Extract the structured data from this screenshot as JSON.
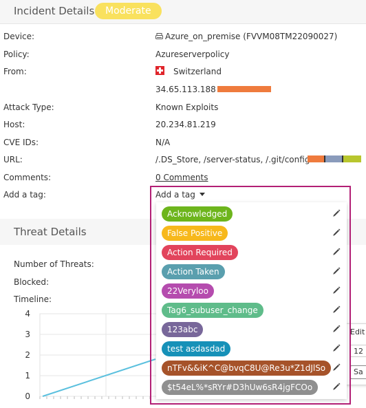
{
  "header": {
    "title": "Incident Details",
    "severity": "Moderate"
  },
  "details": {
    "device_label": "Device:",
    "device_value": "Azure_on_premise (FVVM08TM22090027)",
    "policy_label": "Policy:",
    "policy_value": "Azureserverpolicy",
    "from_label": "From:",
    "from_country": "Switzerland",
    "from_ip": "34.65.113.188",
    "attack_type_label": "Attack Type:",
    "attack_type_value": "Known Exploits",
    "host_label": "Host:",
    "host_value": "20.234.81.219",
    "cve_label": "CVE IDs:",
    "cve_value": "N/A",
    "url_label": "URL:",
    "url_value": "/.DS_Store, /server-status, /.git/config",
    "comments_label": "Comments:",
    "comments_link": "0 Comments",
    "add_tag_label": "Add a tag:"
  },
  "icons": {
    "device": "printer-icon",
    "flag": "switzerland-flag-icon",
    "edit": "pencil-icon",
    "caret": "caret-down-icon"
  },
  "colors": {
    "risk_bar": "#ef7b3d",
    "url_bars": [
      "#ef7b3d",
      "#8a9bbb",
      "#b8c62e"
    ],
    "highlight": "#b21f75",
    "badge": "#f9e15e"
  },
  "tag_dropdown": {
    "trigger_label": "Add a tag",
    "tags": [
      {
        "label": "Acknowledged",
        "color": "#6db51c"
      },
      {
        "label": "False Positive",
        "color": "#f7b81c"
      },
      {
        "label": "Action Required",
        "color": "#e2445c"
      },
      {
        "label": "Action Taken",
        "color": "#5a9fae"
      },
      {
        "label": "22Veryloo",
        "color": "#b54cae"
      },
      {
        "label": "Tag6_subuser_change",
        "color": "#5fbc8a"
      },
      {
        "label": "123abc",
        "color": "#78679a"
      },
      {
        "label": "test asdasdad",
        "color": "#1691b8"
      },
      {
        "label": "nTFv&&iK^C@bvqC8U@Re3u*Z1dJlSo",
        "color": "#a6532a"
      },
      {
        "label": "$t54eL%*sRYr#D3hUw6sR4jgFCOo",
        "color": "#8f8f8f"
      }
    ]
  },
  "threat": {
    "title": "Threat Details",
    "number_label": "Number of Threats:",
    "blocked_label": "Blocked:",
    "timeline_label": "Timeline:"
  },
  "side_panel": {
    "edit_label": "Edit",
    "input_value": "12",
    "save_label": "Sa"
  },
  "chart_data": {
    "type": "line",
    "y_ticks": [
      "4",
      "3",
      "2",
      "1",
      "0"
    ],
    "ylim": [
      0,
      4
    ],
    "grid": true,
    "series": [
      {
        "values": [
          0,
          1.8
        ]
      }
    ],
    "line_color": "#5bc0de"
  }
}
